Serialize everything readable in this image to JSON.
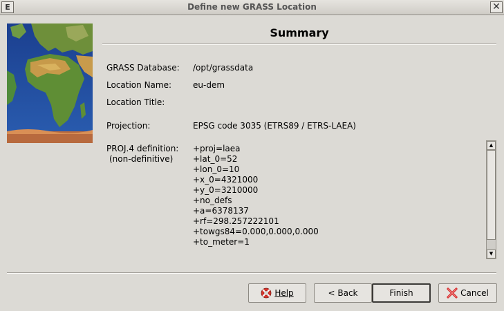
{
  "window": {
    "title": "Define new GRASS Location",
    "menu_glyph": "E",
    "close_glyph": "✕"
  },
  "summary": {
    "heading": "Summary",
    "fields": {
      "database_label": "GRASS Database:",
      "database_value": "/opt/grassdata",
      "location_name_label": "Location Name:",
      "location_name_value": "eu-dem",
      "location_title_label": "Location Title:",
      "location_title_value": "",
      "projection_label": "Projection:",
      "projection_value": "EPSG code 3035 (ETRS89 / ETRS-LAEA)",
      "proj4_label": "PROJ.4 definition:",
      "proj4_sublabel": "(non-definitive)"
    },
    "proj4_lines": [
      "+proj=laea",
      "+lat_0=52",
      "+lon_0=10",
      "+x_0=4321000",
      "+y_0=3210000",
      "+no_defs",
      "+a=6378137",
      "+rf=298.257222101",
      "+towgs84=0.000,0.000,0.000",
      "+to_meter=1"
    ]
  },
  "buttons": {
    "help": {
      "label": "Help",
      "icon": "lifebuoy-icon"
    },
    "back": {
      "label": "< Back"
    },
    "finish": {
      "label": "Finish"
    },
    "cancel": {
      "label": "Cancel",
      "icon": "cancel-x-icon"
    }
  },
  "colors": {
    "dialog_bg": "#dcdad5",
    "ocean": "#1d3a8a",
    "cancel_icon": "#d62b2b",
    "help_icon": "#d9342b"
  }
}
